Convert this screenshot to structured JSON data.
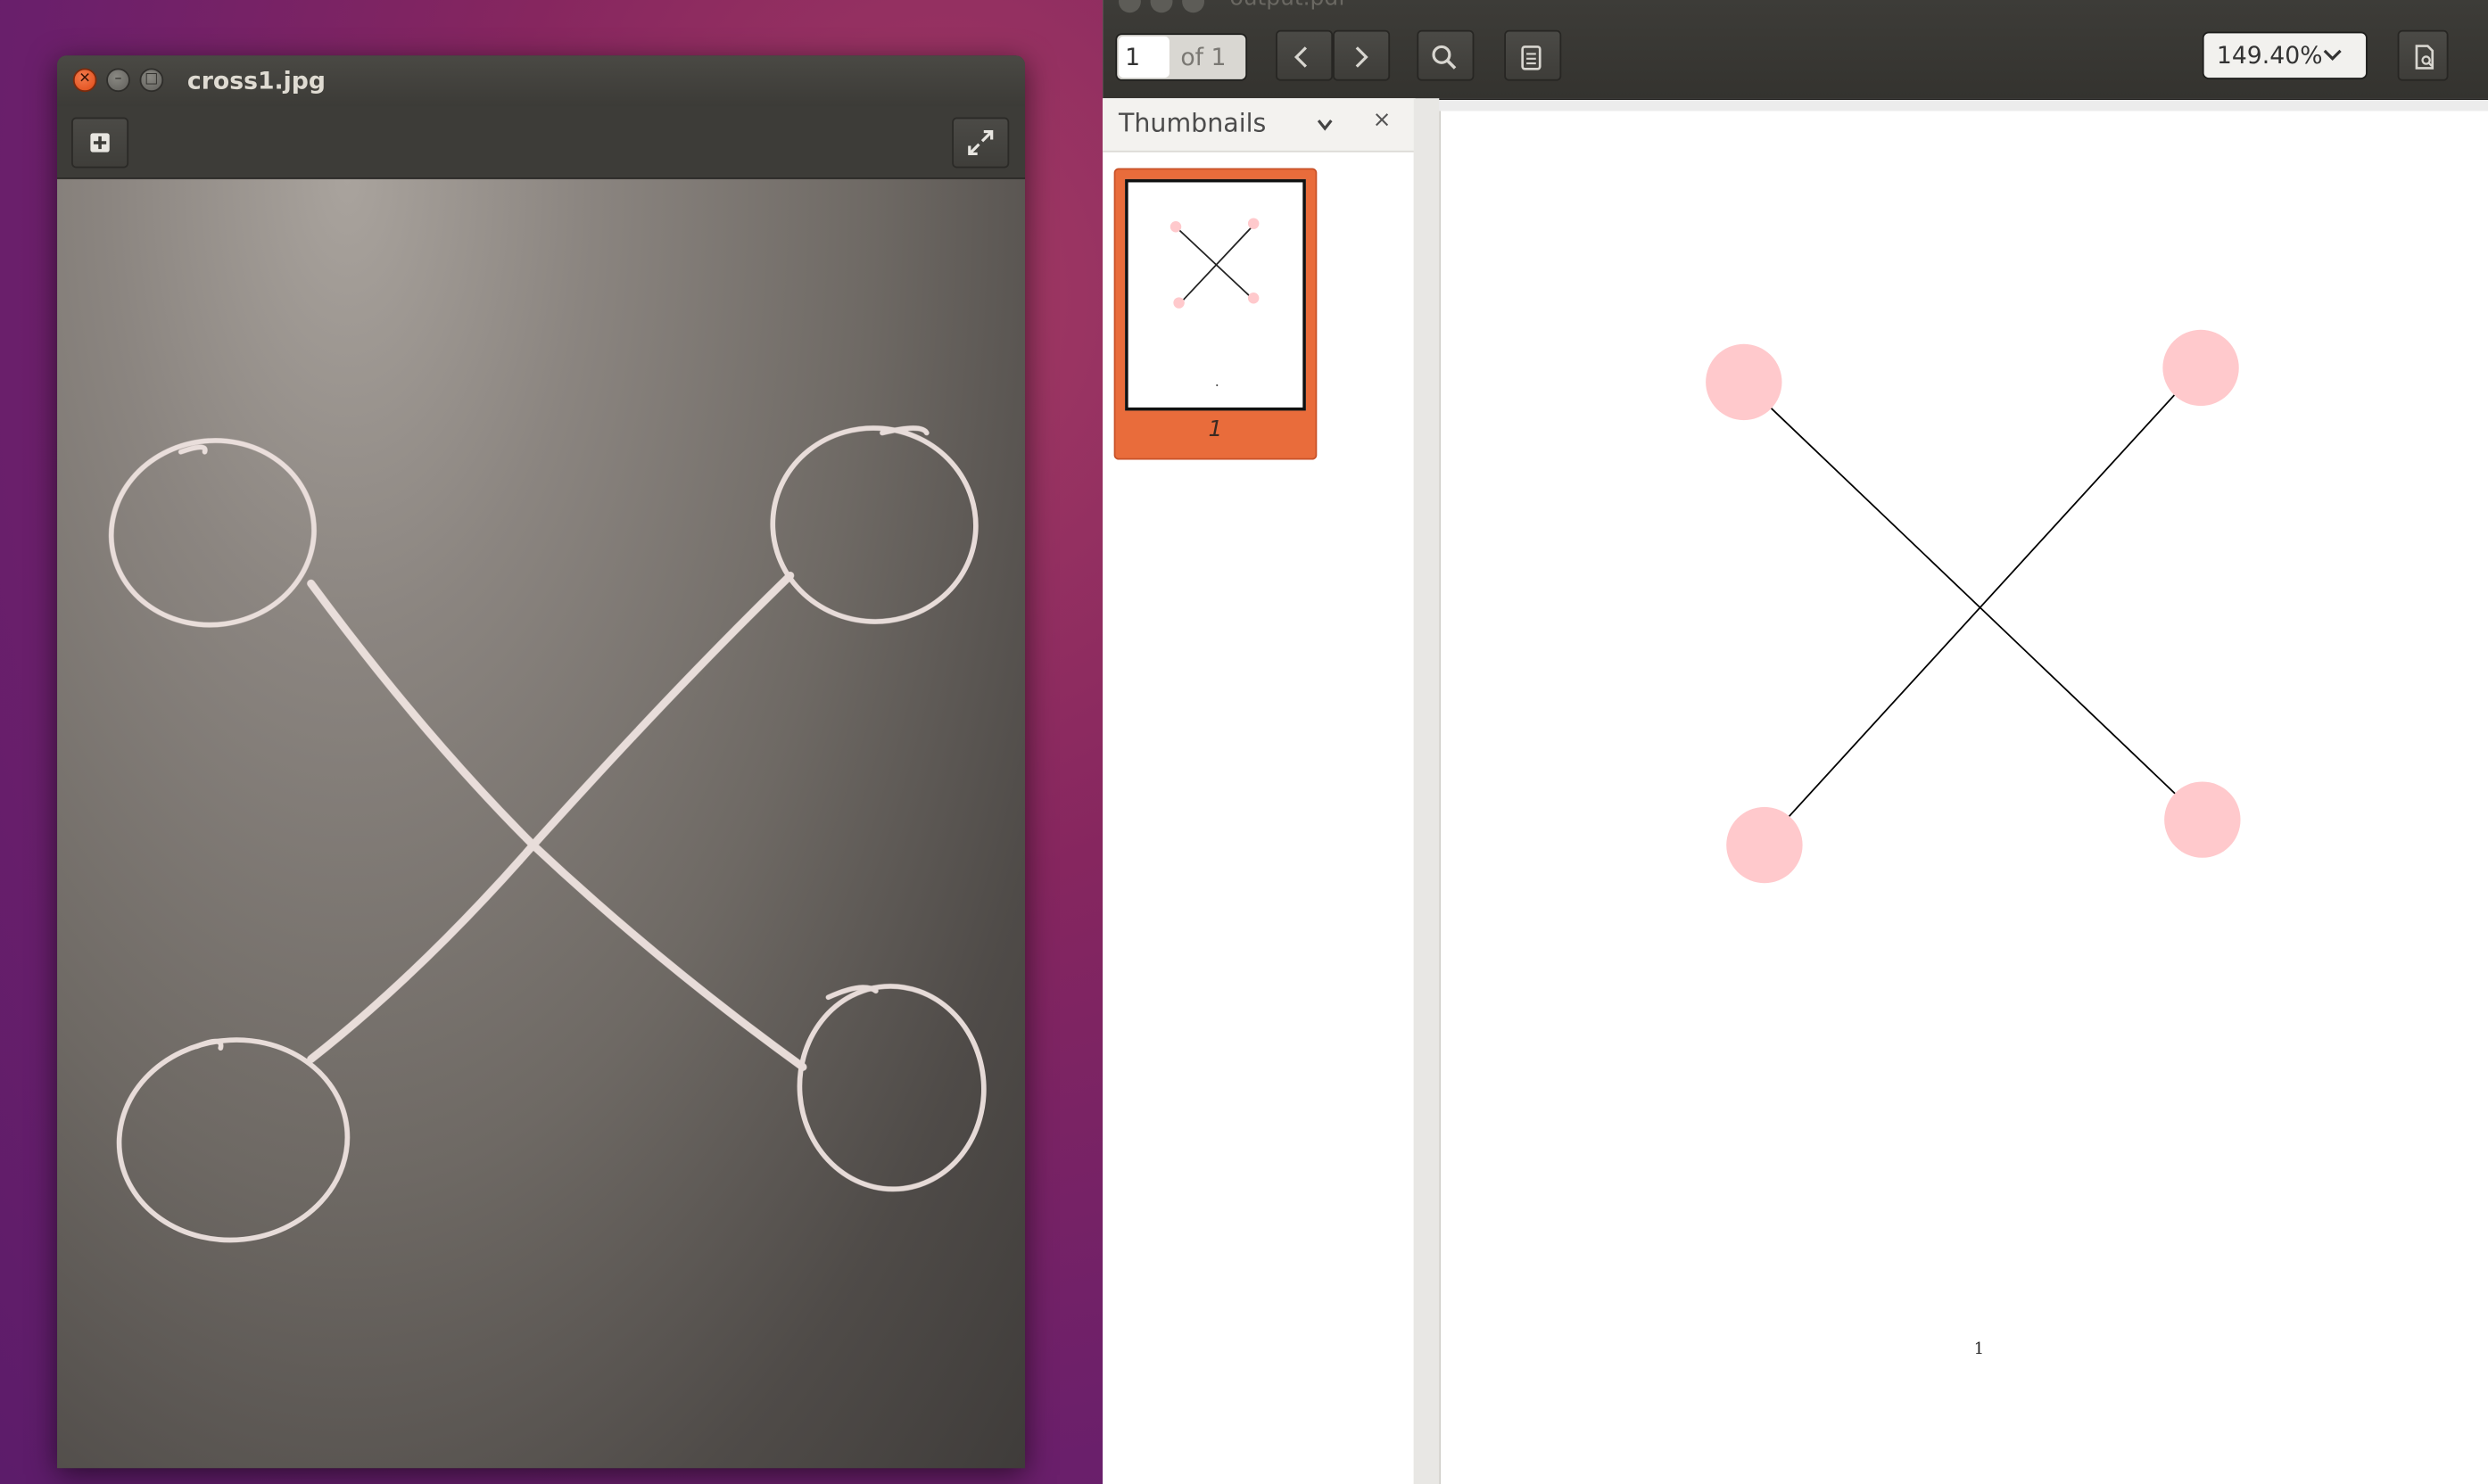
{
  "image_viewer": {
    "window_title": "cross1.jpg",
    "toolbar": {
      "add_icon": "plus-square-icon",
      "fullscreen_icon": "fullscreen-icon"
    }
  },
  "pdf_viewer": {
    "window_title": "output.pdf",
    "toolbar": {
      "page_current": "1",
      "page_total_label": "of 1",
      "prev_icon": "chevron-left-icon",
      "next_icon": "chevron-right-icon",
      "search_icon": "search-icon",
      "annotations_icon": "clipboard-icon",
      "zoom_value": "149.40%",
      "document_icon": "document-icon"
    },
    "sidebar": {
      "title": "Thumbnails",
      "thumbnails": [
        {
          "page_label": "1",
          "selected": true
        }
      ]
    },
    "page": {
      "page_number_text": "1",
      "node_color": "#ffc9cc",
      "edge_color": "#000000"
    }
  },
  "colors": {
    "accent": "#e96c3b",
    "close_button": "#df4a16",
    "toolbar_dark": "#3c3b37"
  }
}
